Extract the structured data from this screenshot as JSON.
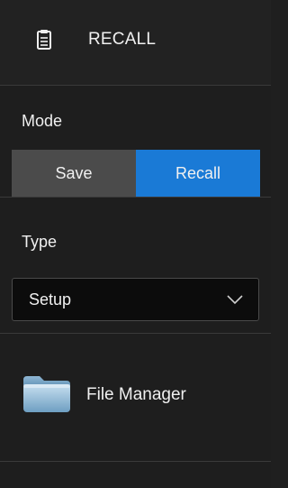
{
  "header": {
    "title": "RECALL",
    "icon": "clipboard-icon"
  },
  "mode": {
    "label": "Mode",
    "options": [
      "Save",
      "Recall"
    ],
    "selected": "Recall",
    "active_color": "#1a7ad6",
    "inactive_color": "#4b4b4b"
  },
  "type": {
    "label": "Type",
    "value": "Setup"
  },
  "file_manager": {
    "label": "File Manager",
    "icon": "folder-icon"
  }
}
